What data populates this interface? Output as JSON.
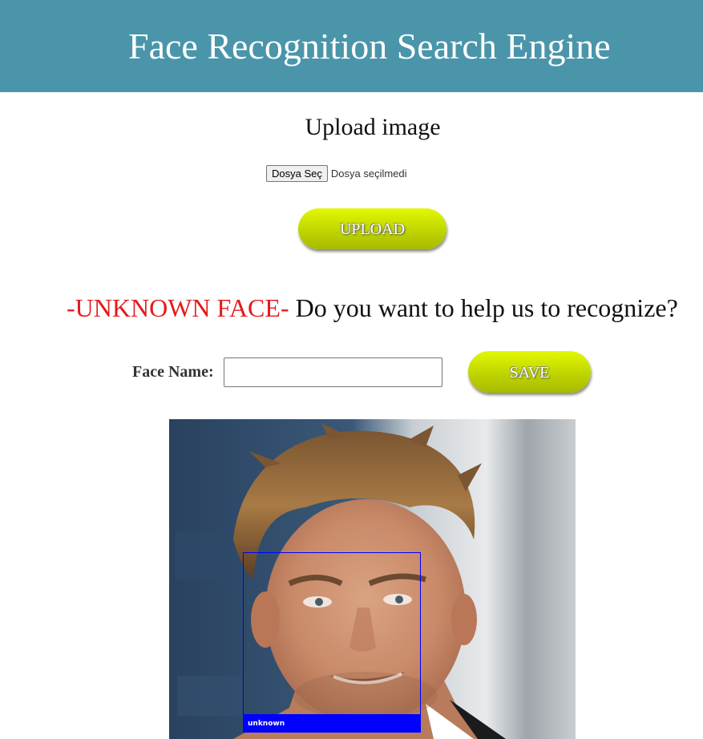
{
  "header": {
    "title": "Face Recognition Search Engine",
    "background_color": "#4a95aa"
  },
  "upload": {
    "heading": "Upload image",
    "choose_file_label": "Dosya Seç",
    "file_status": "Dosya seçilmedi",
    "upload_button_label": "UPLOAD"
  },
  "result": {
    "unknown_label": "-UNKNOWN FACE-",
    "prompt": " Do you want to help us to recognize?",
    "unknown_color": "#e41b1b"
  },
  "save_form": {
    "face_name_label": "Face Name:",
    "face_name_value": "",
    "save_button_label": "SAVE"
  },
  "photo": {
    "face_label": "unknown",
    "box_color": "#0000ff"
  },
  "colors": {
    "button_gradient_top": "#e3f800",
    "button_gradient_bottom": "#a8bb00"
  }
}
